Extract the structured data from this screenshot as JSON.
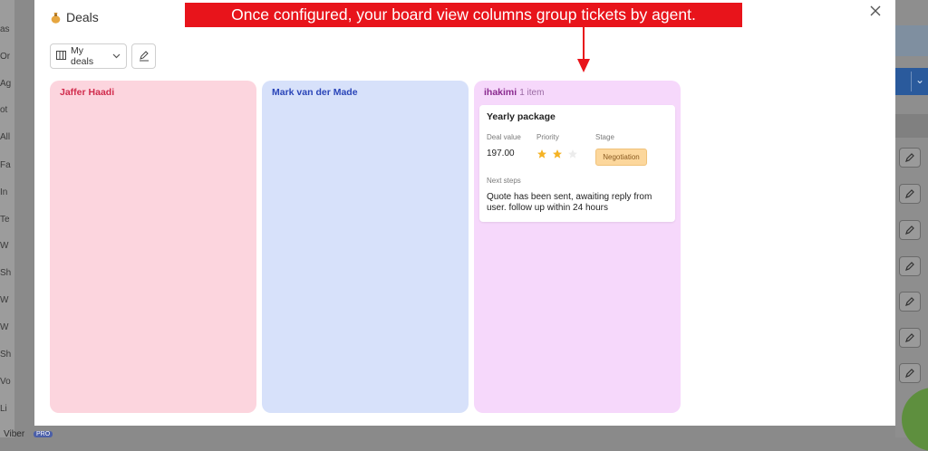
{
  "background": {
    "sidebar_fragments": [
      "as",
      "Or",
      "Ag",
      "ot",
      "All",
      "Fa",
      "In",
      "Te",
      "W",
      "Sh",
      "W",
      "W",
      "Sh",
      "Vo",
      "Li"
    ],
    "viber_label": "Viber",
    "pro_badge": "PRO"
  },
  "modal": {
    "title": "Deals",
    "title_icon": "money-bag-icon",
    "close_icon": "close-icon",
    "view_select": {
      "icon": "board-view-icon",
      "value": "My deals"
    },
    "edit_icon": "edit-pen-icon"
  },
  "columns": [
    {
      "title": "Jaffer Haadi",
      "count": "",
      "color": "#fcd5de"
    },
    {
      "title": "Mark van der Made",
      "count": "",
      "color": "#d7e1fa"
    },
    {
      "title": "ihakimi",
      "count": "1 item",
      "color": "#f6d8fb",
      "cards": [
        {
          "title": "Yearly package",
          "deal_value_label": "Deal value",
          "deal_value": "197.00",
          "priority_label": "Priority",
          "priority_stars": 2,
          "priority_max": 3,
          "stage_label": "Stage",
          "stage": "Negotiation",
          "next_steps_label": "Next steps",
          "next_steps": "Quote has been sent, awaiting reply from user. follow up within 24 hours"
        }
      ]
    }
  ],
  "annotation": {
    "text": "Once configured, your board view columns group tickets by agent.",
    "color": "#e8141b"
  }
}
